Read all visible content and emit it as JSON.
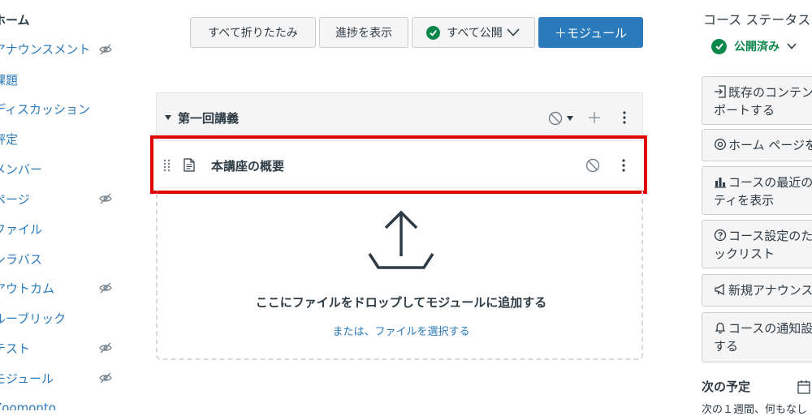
{
  "nav": {
    "items": [
      {
        "label": "ホーム",
        "hidden": false,
        "active": true
      },
      {
        "label": "アナウンスメント",
        "hidden": true
      },
      {
        "label": "課題",
        "hidden": false
      },
      {
        "label": "ディスカッション",
        "hidden": false
      },
      {
        "label": "評定",
        "hidden": false
      },
      {
        "label": "メンバー",
        "hidden": false
      },
      {
        "label": "ページ",
        "hidden": true
      },
      {
        "label": "ファイル",
        "hidden": false
      },
      {
        "label": "シラバス",
        "hidden": false
      },
      {
        "label": "アウトカム",
        "hidden": true
      },
      {
        "label": "ルーブリック",
        "hidden": false
      },
      {
        "label": "テスト",
        "hidden": true
      },
      {
        "label": "モジュール",
        "hidden": true
      },
      {
        "label": "Zoomonto",
        "hidden": false
      }
    ]
  },
  "toolbar": {
    "collapse_all": "すべて折りたたみ",
    "view_progress": "進捗を表示",
    "publish_all": "すべて公開",
    "add_module": "＋モジュール"
  },
  "module": {
    "title": "第一回講義",
    "item_title": "本講座の概要",
    "drop_title": "ここにファイルをドロップしてモジュールに追加する",
    "drop_link": "または、ファイルを選択する"
  },
  "sidebar": {
    "status_title": "コース ステータス",
    "status_value": "公開済み",
    "buttons": [
      {
        "icon": "import-icon",
        "line1": "既存のコンテンツをイン",
        "line2": "ポートする"
      },
      {
        "icon": "home-target-icon",
        "line1": "ホーム ページを選択",
        "line2": ""
      },
      {
        "icon": "bar-chart-icon",
        "line1": "コースの最近のアクティビ",
        "line2": "ティを表示"
      },
      {
        "icon": "question-icon",
        "line1": "コース設定のためのチェ",
        "line2": "ックリスト"
      },
      {
        "icon": "megaphone-icon",
        "line1": "新規アナウンスメント",
        "line2": ""
      },
      {
        "icon": "bell-icon",
        "line1": "コースの通知設定を表示",
        "line2": "する"
      }
    ],
    "todo_title": "次の予定",
    "todo_sub": "次の１週間、何もなし"
  },
  "colors": {
    "link": "#2b7abc",
    "published": "#0b874b",
    "highlight": "#e00000",
    "primary": "#2b7abc"
  }
}
